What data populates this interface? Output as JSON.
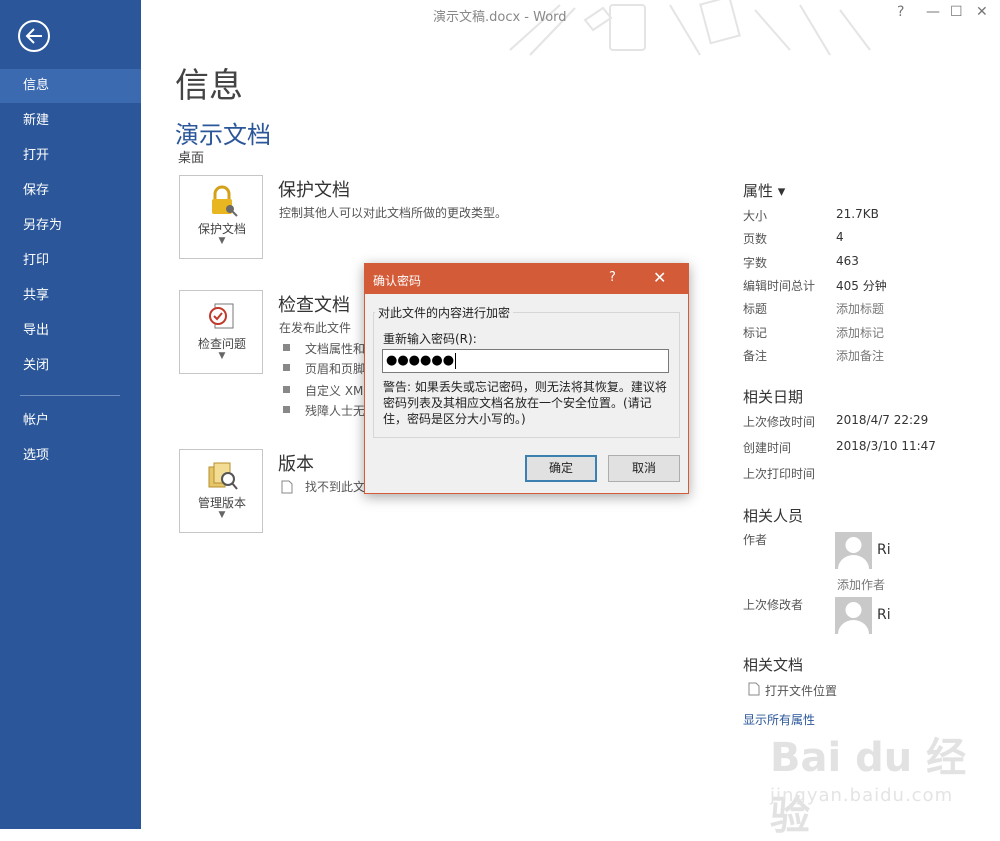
{
  "window": {
    "title": "演示文稿.docx - Word",
    "help": "?",
    "minimize": "—",
    "maximize": "☐",
    "close": "✕"
  },
  "sidebar": {
    "items": [
      {
        "label": "信息"
      },
      {
        "label": "新建"
      },
      {
        "label": "打开"
      },
      {
        "label": "保存"
      },
      {
        "label": "另存为"
      },
      {
        "label": "打印"
      },
      {
        "label": "共享"
      },
      {
        "label": "导出"
      },
      {
        "label": "关闭"
      },
      {
        "label": "帐户"
      },
      {
        "label": "选项"
      }
    ]
  },
  "main": {
    "page_title": "信息",
    "doc_name": "演示文档",
    "doc_location": "桌面",
    "protect": {
      "tile_label": "保护文档",
      "title": "保护文档",
      "desc": "控制其他人可以对此文档所做的更改类型。"
    },
    "inspect": {
      "tile_label": "检查问题",
      "title": "检查文档",
      "desc": "在发布此文件",
      "bullets": [
        "文档属性和",
        "页眉和页脚",
        "自定义 XM",
        "残障人士无"
      ]
    },
    "versions": {
      "tile_label": "管理版本",
      "title": "版本",
      "desc": "找不到此文"
    }
  },
  "properties": {
    "heading": "属性 ▾",
    "rows": [
      {
        "label": "大小",
        "value": "21.7KB"
      },
      {
        "label": "页数",
        "value": "4"
      },
      {
        "label": "字数",
        "value": "463"
      },
      {
        "label": "编辑时间总计",
        "value": "405 分钟"
      },
      {
        "label": "标题",
        "value": "添加标题"
      },
      {
        "label": "标记",
        "value": "添加标记"
      },
      {
        "label": "备注",
        "value": "添加备注"
      }
    ],
    "dates_heading": "相关日期",
    "dates": [
      {
        "label": "上次修改时间",
        "value": "2018/4/7 22:29"
      },
      {
        "label": "创建时间",
        "value": "2018/3/10 11:47"
      },
      {
        "label": "上次打印时间",
        "value": ""
      }
    ],
    "people_heading": "相关人员",
    "author_label": "作者",
    "author_name": "Ri",
    "add_author": "添加作者",
    "last_modified_by_label": "上次修改者",
    "last_modified_by_name": "Ri",
    "docs_heading": "相关文档",
    "open_location": "打开文件位置",
    "show_all": "显示所有属性"
  },
  "dialog": {
    "title": "确认密码",
    "help": "?",
    "close": "✕",
    "group_legend": "对此文件的内容进行加密",
    "password_label": "重新输入密码(R):",
    "password_value": "●●●●●●",
    "warning": "警告: 如果丢失或忘记密码，则无法将其恢复。建议将密码列表及其相应文档名放在一个安全位置。(请记住，密码是区分大小写的。)",
    "ok": "确定",
    "cancel": "取消"
  },
  "watermark": {
    "brand": "Bai du 经验",
    "url": "jingyan.baidu.com"
  },
  "colors": {
    "sidebar": "#2b579a",
    "accent": "#2b579a",
    "dialog_title": "#d35b38"
  }
}
